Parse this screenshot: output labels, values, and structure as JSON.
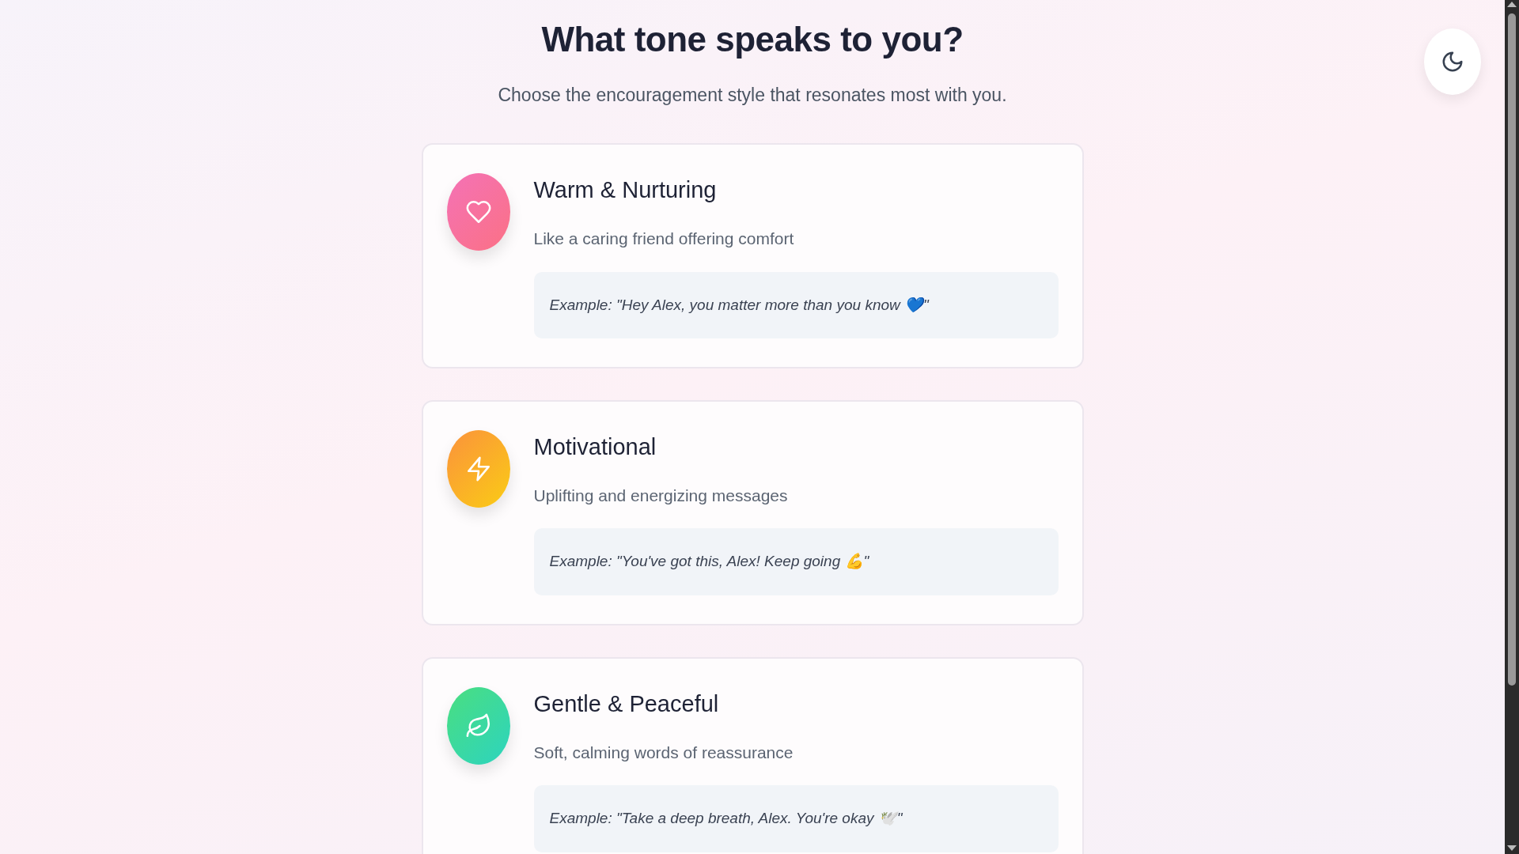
{
  "heading": "What tone speaks to you?",
  "subheading": "Choose the encouragement style that resonates most with you.",
  "theme_toggle": {
    "dark_mode": false
  },
  "tones": [
    {
      "kind": "heart",
      "title": "Warm & Nurturing",
      "description": "Like a caring friend offering comfort",
      "example": "Example: \"Hey Alex, you matter more than you know 💙\""
    },
    {
      "kind": "bolt",
      "title": "Motivational",
      "description": "Uplifting and energizing messages",
      "example": "Example: \"You've got this, Alex! Keep going 💪\""
    },
    {
      "kind": "leaf",
      "title": "Gentle & Peaceful",
      "description": "Soft, calming words of reassurance",
      "example": "Example: \"Take a deep breath, Alex. You're okay 🕊️\""
    }
  ]
}
